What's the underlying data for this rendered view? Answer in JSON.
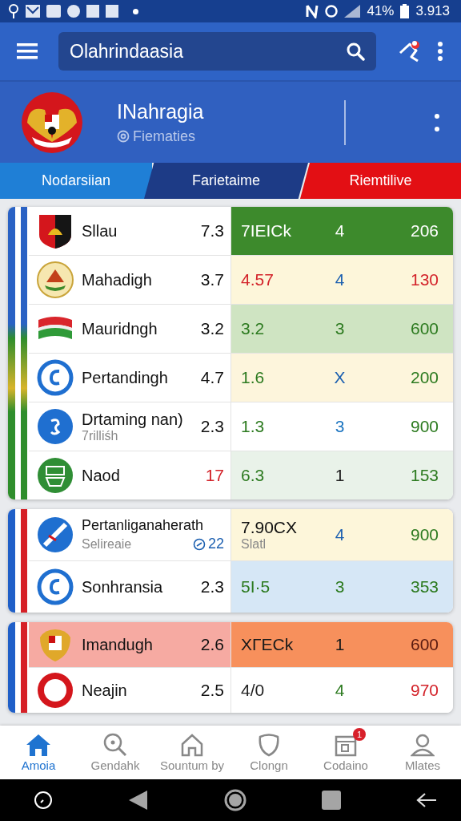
{
  "status_bar": {
    "battery": "41%",
    "time": "3.913"
  },
  "app_bar": {
    "search": {
      "value": "Olahrindaasia"
    }
  },
  "profile": {
    "title": "INahragia",
    "subtitle": "Fiematies"
  },
  "tabs": [
    {
      "label": "Nodarsiian",
      "selected": false,
      "color": "#1f7fd6"
    },
    {
      "label": "Farietaime",
      "selected": false,
      "color": "#1d3b86"
    },
    {
      "label": "Riemtilive",
      "selected": false,
      "color": "#e30f14"
    }
  ],
  "cards": [
    {
      "rows": [
        {
          "name": "Sllau",
          "score": {
            "text": "7.3",
            "color": "#111111"
          },
          "color": "#3d8a2c",
          "cells": [
            {
              "text": "7IEICk",
              "color": "#ffffff"
            },
            {
              "text": "4",
              "color": "#ffffff"
            },
            {
              "text": "206",
              "color": "#ffffff"
            }
          ]
        },
        {
          "name": "Mahadigh",
          "score": {
            "text": "3.7",
            "color": "#111111"
          },
          "color": "#fdf6da",
          "cells": [
            {
              "text": "4.57",
              "color": "#d3232a"
            },
            {
              "text": "4",
              "color": "#1b5fb0"
            },
            {
              "text": "130",
              "color": "#d3232a"
            }
          ]
        },
        {
          "name": "Mauridngh",
          "score": {
            "text": "3.2",
            "color": "#111111"
          },
          "color": "#cfe4c2",
          "cells": [
            {
              "text": "3.2",
              "color": "#2c7a1f"
            },
            {
              "text": "3",
              "color": "#2c7a1f"
            },
            {
              "text": "600",
              "color": "#2c7a1f"
            }
          ]
        },
        {
          "name": "Pertandingh",
          "score": {
            "text": "4.7",
            "color": "#111111"
          },
          "color": "#fdf5dc",
          "cells": [
            {
              "text": "1.6",
              "color": "#2c7a1f"
            },
            {
              "text": "X",
              "color": "#1b5fb0"
            },
            {
              "text": "200",
              "color": "#2c7a1f"
            }
          ]
        },
        {
          "name": "Drtaming nan)",
          "sub": "7rilliśh",
          "score": {
            "text": "2.3",
            "color": "#111111"
          },
          "color": "#ffffff",
          "cells": [
            {
              "text": "1.3",
              "color": "#2c7a1f"
            },
            {
              "text": "3",
              "color": "#1b74c0"
            },
            {
              "text": "900",
              "color": "#2c7a1f"
            }
          ]
        },
        {
          "name": "Naod",
          "score": {
            "text": "17",
            "color": "#d3232a"
          },
          "color": "#e9f2e9",
          "cells": [
            {
              "text": "6.3",
              "color": "#2c7a1f"
            },
            {
              "text": "1",
              "color": "#222222"
            },
            {
              "text": "153",
              "color": "#2c7a1f"
            }
          ]
        }
      ]
    },
    {
      "rows": [
        {
          "name": "Pertanliganaherath",
          "sub": "Selireaie",
          "score": {
            "text": "22",
            "color": "#1b5fb0"
          },
          "color": "#fdf6da",
          "cells": [
            {
              "text": "7.90CX",
              "sub": "Slatl",
              "color": "#111111"
            },
            {
              "text": "4",
              "color": "#1b5fb0"
            },
            {
              "text": "900",
              "color": "#2c7a1f"
            }
          ]
        },
        {
          "name": "Sonhransia",
          "score": {
            "text": "2.3",
            "color": "#111111"
          },
          "color": "#d6e7f6",
          "cells": [
            {
              "text": "5I·5",
              "color": "#2c7a1f"
            },
            {
              "text": "3",
              "color": "#2c7a1f"
            },
            {
              "text": "353",
              "color": "#2c7a1f"
            }
          ]
        }
      ]
    },
    {
      "rows": [
        {
          "name": "Imandugh",
          "score": {
            "text": "2.6",
            "color": "#111111"
          },
          "color": "#f7905c",
          "cells": [
            {
              "text": "XΓECk",
              "color": "#1a1a1a"
            },
            {
              "text": "1",
              "color": "#1a1a1a"
            },
            {
              "text": "600",
              "color": "#5a1a10"
            }
          ]
        },
        {
          "name": "Neajin",
          "score": {
            "text": "2.5",
            "color": "#111111"
          },
          "color": "#ffffff",
          "cells": [
            {
              "text": "4/0",
              "color": "#222222"
            },
            {
              "text": "4",
              "color": "#2c7a1f"
            },
            {
              "text": "970",
              "color": "#d3232a"
            }
          ]
        }
      ]
    }
  ],
  "bottom_nav": [
    {
      "label": "Amoia",
      "selected": true
    },
    {
      "label": "Gendahk",
      "selected": false
    },
    {
      "label": "Sountum by",
      "selected": false
    },
    {
      "label": "Clongn",
      "selected": false
    },
    {
      "label": "Codaino",
      "selected": false,
      "badge": "1"
    },
    {
      "label": "Mlates",
      "selected": false
    }
  ]
}
